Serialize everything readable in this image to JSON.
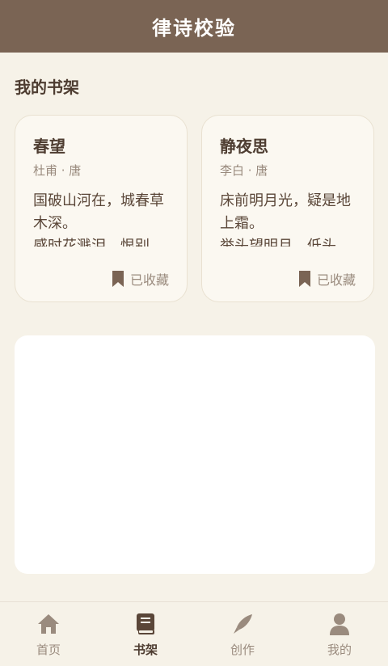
{
  "header": {
    "title": "律诗校验"
  },
  "section": {
    "title": "我的书架"
  },
  "cards": [
    {
      "title": "春望",
      "meta": "杜甫 · 唐",
      "lines": [
        "国破山河在，城春草木深。",
        "感时花溅泪，恨别"
      ],
      "status": "已收藏"
    },
    {
      "title": "静夜思",
      "meta": "李白 · 唐",
      "lines": [
        "床前明月光，疑是地上霜。",
        "举头望明月，低头"
      ],
      "status": "已收藏"
    }
  ],
  "tabs": [
    {
      "label": "首页",
      "icon": "home-icon"
    },
    {
      "label": "书架",
      "icon": "book-icon",
      "active": true
    },
    {
      "label": "创作",
      "icon": "pen-icon"
    },
    {
      "label": "我的",
      "icon": "user-icon"
    }
  ],
  "colors": {
    "header_bg": "#7a6454",
    "page_bg": "#f6f2e8",
    "card_bg": "#fbf8f1",
    "text_dark": "#4e3d31",
    "text_muted": "#9a8b7e"
  }
}
